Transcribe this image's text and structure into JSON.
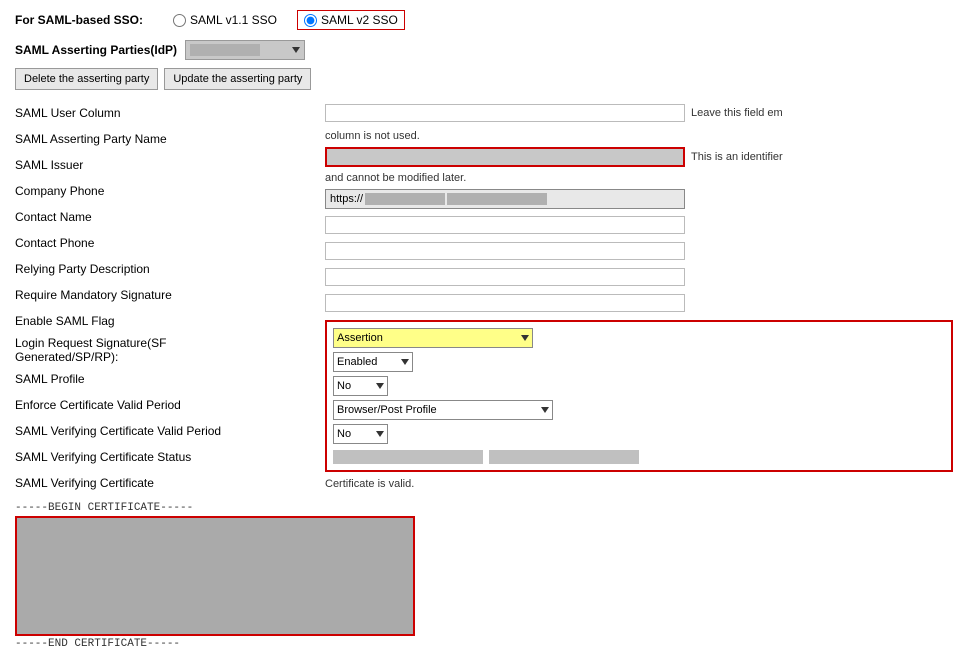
{
  "page": {
    "sso_header_label": "For SAML-based SSO:",
    "saml_v1_label": "SAML v1.1 SSO",
    "saml_v2_label": "SAML v2 SSO",
    "asserting_parties_label": "SAML Asserting Parties(IdP)",
    "blurred_party_name": "",
    "delete_btn_label": "Delete the asserting party",
    "update_btn_label": "Update the asserting party",
    "fields": [
      {
        "label": "SAML User Column",
        "type": "empty"
      },
      {
        "label": "SAML Asserting Party Name",
        "type": "blurred_red"
      },
      {
        "label": "SAML Issuer",
        "type": "issuer"
      },
      {
        "label": "Company Phone",
        "type": "empty"
      },
      {
        "label": "Contact Name",
        "type": "empty"
      },
      {
        "label": "Contact Phone",
        "type": "empty"
      },
      {
        "label": "Relying Party Description",
        "type": "empty"
      },
      {
        "label": "Require Mandatory Signature",
        "type": "dropdown_assertion"
      },
      {
        "label": "Enable SAML Flag",
        "type": "dropdown_enabled"
      },
      {
        "label": "Login Request Signature(SF Generated/SP/RP):",
        "type": "dropdown_no"
      },
      {
        "label": "SAML Profile",
        "type": "dropdown_browser"
      },
      {
        "label": "Enforce Certificate Valid Period",
        "type": "dropdown_no2"
      },
      {
        "label": "SAML Verifying Certificate Valid Period",
        "type": "cert_blurred"
      },
      {
        "label": "SAML Verifying Certificate Status",
        "type": "cert_valid_text"
      },
      {
        "label": "SAML Verifying Certificate",
        "type": "cert_section"
      }
    ],
    "notes": {
      "user_column_note": "column is not used.",
      "asserting_party_note": "and cannot be modified later.",
      "asserting_party_hint": "This is an identifier",
      "leave_empty_hint": "Leave this field em"
    },
    "dropdowns": {
      "assertion_label": "Assertion",
      "enabled_label": "Enabled",
      "no_label": "No",
      "browser_post_label": "Browser/Post Profile",
      "no2_label": "No"
    },
    "cert": {
      "begin_label": "-----BEGIN CERTIFICATE-----",
      "end_label": "-----END CERTIFICATE-----",
      "valid_text": "Certificate is valid."
    }
  }
}
